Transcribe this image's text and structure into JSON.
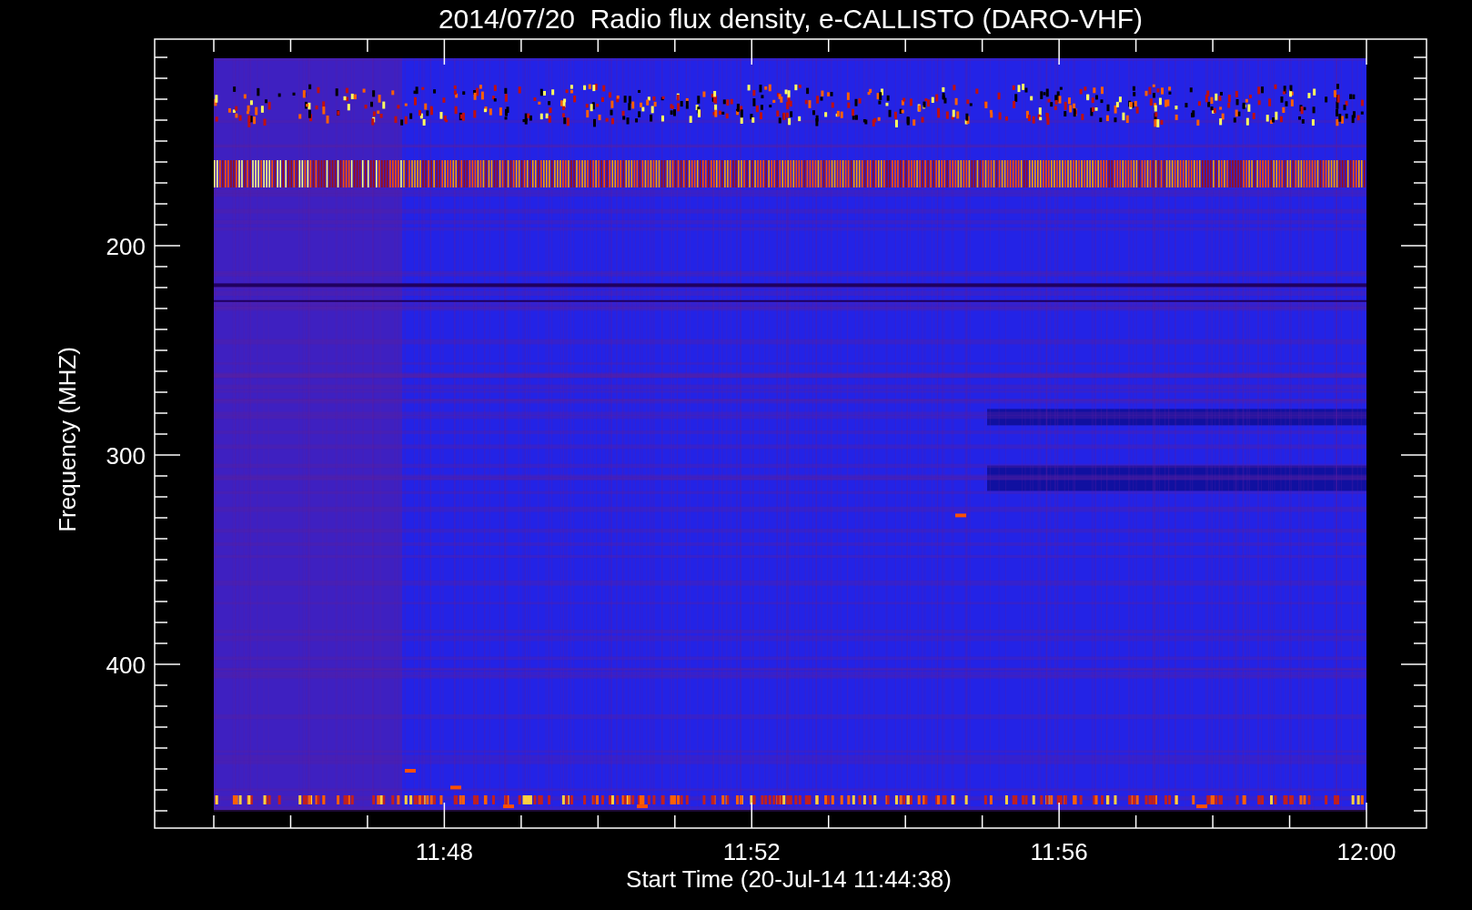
{
  "title": "2014/07/20  Radio flux density, e-CALLISTO (DARO-VHF)",
  "y_axis": {
    "label": "Frequency (MHZ)",
    "ticks": [
      "200",
      "300",
      "400"
    ]
  },
  "x_axis": {
    "label": "Start Time (20-Jul-14 11:44:38)",
    "ticks": [
      "11:48",
      "11:52",
      "11:56",
      "12:00"
    ]
  }
}
